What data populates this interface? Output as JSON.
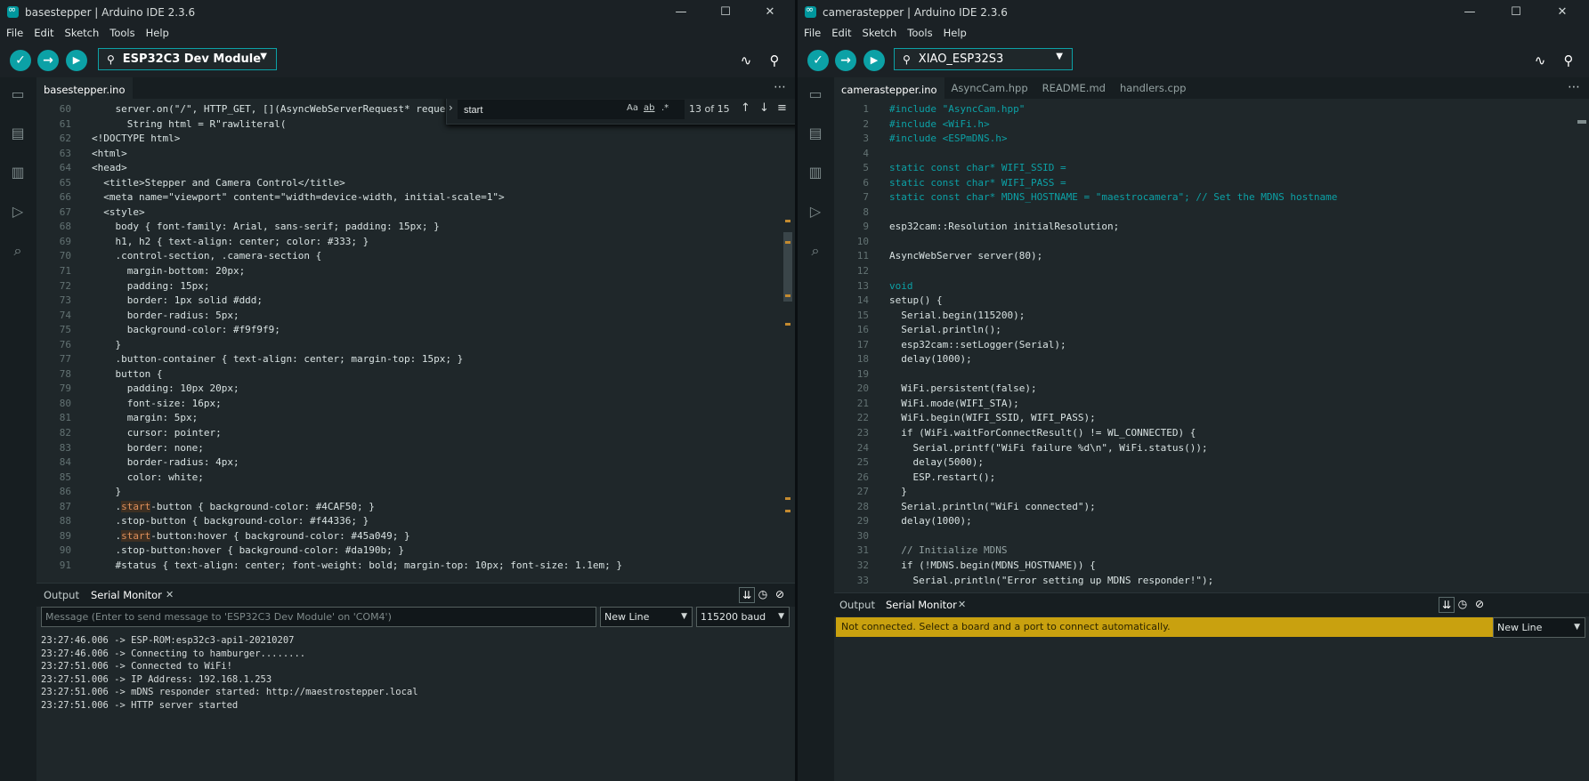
{
  "left": {
    "title": "basestepper | Arduino IDE 2.3.6",
    "menu": [
      "File",
      "Edit",
      "Sketch",
      "Tools",
      "Help"
    ],
    "board": "ESP32C3 Dev Module",
    "tabs": [
      "basestepper.ino"
    ],
    "find": {
      "query": "start",
      "count": "13 of 15",
      "case": "Aa",
      "word": "ab",
      "regex": ".*"
    },
    "code": [
      {
        "n": "60",
        "t": "    server.on(\"/\", HTTP_GET, [](AsyncWebServerRequest* request"
      },
      {
        "n": "61",
        "t": "      String html = R\"rawliteral("
      },
      {
        "n": "62",
        "t": "<!DOCTYPE html>"
      },
      {
        "n": "63",
        "t": "<html>"
      },
      {
        "n": "64",
        "t": "<head>"
      },
      {
        "n": "65",
        "t": "  <title>Stepper and Camera Control</title>"
      },
      {
        "n": "66",
        "t": "  <meta name=\"viewport\" content=\"width=device-width, initial-scale=1\">"
      },
      {
        "n": "67",
        "t": "  <style>"
      },
      {
        "n": "68",
        "t": "    body { font-family: Arial, sans-serif; padding: 15px; }"
      },
      {
        "n": "69",
        "t": "    h1, h2 { text-align: center; color: #333; }"
      },
      {
        "n": "70",
        "t": "    .control-section, .camera-section {"
      },
      {
        "n": "71",
        "t": "      margin-bottom: 20px;"
      },
      {
        "n": "72",
        "t": "      padding: 15px;"
      },
      {
        "n": "73",
        "t": "      border: 1px solid #ddd;"
      },
      {
        "n": "74",
        "t": "      border-radius: 5px;"
      },
      {
        "n": "75",
        "t": "      background-color: #f9f9f9;"
      },
      {
        "n": "76",
        "t": "    }"
      },
      {
        "n": "77",
        "t": "    .button-container { text-align: center; margin-top: 15px; }"
      },
      {
        "n": "78",
        "t": "    button {"
      },
      {
        "n": "79",
        "t": "      padding: 10px 20px;"
      },
      {
        "n": "80",
        "t": "      font-size: 16px;"
      },
      {
        "n": "81",
        "t": "      margin: 5px;"
      },
      {
        "n": "82",
        "t": "      cursor: pointer;"
      },
      {
        "n": "83",
        "t": "      border: none;"
      },
      {
        "n": "84",
        "t": "      border-radius: 4px;"
      },
      {
        "n": "85",
        "t": "      color: white;"
      },
      {
        "n": "86",
        "t": "    }"
      },
      {
        "n": "87",
        "t": "    .start-button { background-color: #4CAF50; }",
        "hl": "start"
      },
      {
        "n": "88",
        "t": "    .stop-button { background-color: #f44336; }"
      },
      {
        "n": "89",
        "t": "    .start-button:hover { background-color: #45a049; }",
        "hl": "start"
      },
      {
        "n": "90",
        "t": "    .stop-button:hover { background-color: #da190b; }"
      },
      {
        "n": "91",
        "t": "    #status { text-align: center; font-weight: bold; margin-top: 10px; font-size: 1.1em; }"
      }
    ],
    "panel": {
      "tabs": [
        "Output",
        "Serial Monitor"
      ],
      "placeholder": "Message (Enter to send message to 'ESP32C3 Dev Module' on 'COM4')",
      "line_ending": "New Line",
      "baud": "115200 baud",
      "output": [
        "23:27:46.006 -> ESP-ROM:esp32c3-api1-20210207",
        "23:27:46.006 -> Connecting to hamburger........",
        "23:27:51.006 -> Connected to WiFi!",
        "23:27:51.006 -> IP Address: 192.168.1.253",
        "23:27:51.006 -> mDNS responder started: http://maestrostepper.local",
        "23:27:51.006 -> HTTP server started"
      ]
    }
  },
  "right": {
    "title": "camerastepper | Arduino IDE 2.3.6",
    "menu": [
      "File",
      "Edit",
      "Sketch",
      "Tools",
      "Help"
    ],
    "board": "XIAO_ESP32S3",
    "tabs": [
      "camerastepper.ino",
      "AsyncCam.hpp",
      "README.md",
      "handlers.cpp"
    ],
    "code": [
      {
        "n": "1",
        "t": "#include \"AsyncCam.hpp\""
      },
      {
        "n": "2",
        "t": "#include <WiFi.h>"
      },
      {
        "n": "3",
        "t": "#include <ESPmDNS.h>"
      },
      {
        "n": "4",
        "t": ""
      },
      {
        "n": "5",
        "t": "static const char* WIFI_SSID ="
      },
      {
        "n": "6",
        "t": "static const char* WIFI_PASS ="
      },
      {
        "n": "7",
        "t": "static const char* MDNS_HOSTNAME = \"maestrocamera\"; // Set the MDNS hostname"
      },
      {
        "n": "8",
        "t": ""
      },
      {
        "n": "9",
        "t": "esp32cam::Resolution initialResolution;"
      },
      {
        "n": "10",
        "t": ""
      },
      {
        "n": "11",
        "t": "AsyncWebServer server(80);"
      },
      {
        "n": "12",
        "t": ""
      },
      {
        "n": "13",
        "t": "void"
      },
      {
        "n": "14",
        "t": "setup() {"
      },
      {
        "n": "15",
        "t": "  Serial.begin(115200);"
      },
      {
        "n": "16",
        "t": "  Serial.println();"
      },
      {
        "n": "17",
        "t": "  esp32cam::setLogger(Serial);"
      },
      {
        "n": "18",
        "t": "  delay(1000);"
      },
      {
        "n": "19",
        "t": ""
      },
      {
        "n": "20",
        "t": "  WiFi.persistent(false);"
      },
      {
        "n": "21",
        "t": "  WiFi.mode(WIFI_STA);"
      },
      {
        "n": "22",
        "t": "  WiFi.begin(WIFI_SSID, WIFI_PASS);"
      },
      {
        "n": "23",
        "t": "  if (WiFi.waitForConnectResult() != WL_CONNECTED) {"
      },
      {
        "n": "24",
        "t": "    Serial.printf(\"WiFi failure %d\\n\", WiFi.status());"
      },
      {
        "n": "25",
        "t": "    delay(5000);"
      },
      {
        "n": "26",
        "t": "    ESP.restart();"
      },
      {
        "n": "27",
        "t": "  }"
      },
      {
        "n": "28",
        "t": "  Serial.println(\"WiFi connected\");"
      },
      {
        "n": "29",
        "t": "  delay(1000);"
      },
      {
        "n": "30",
        "t": ""
      },
      {
        "n": "31",
        "t": "  // Initialize MDNS"
      },
      {
        "n": "32",
        "t": "  if (!MDNS.begin(MDNS_HOSTNAME)) {"
      },
      {
        "n": "33",
        "t": "    Serial.println(\"Error setting up MDNS responder!\");"
      }
    ],
    "panel": {
      "tabs": [
        "Output",
        "Serial Monitor"
      ],
      "notice": "Not connected. Select a board and a port to connect automatically.",
      "line_ending": "New Line"
    }
  },
  "colors": {
    "accent": "#0ca1a6",
    "highlight": "#c9a10f"
  }
}
